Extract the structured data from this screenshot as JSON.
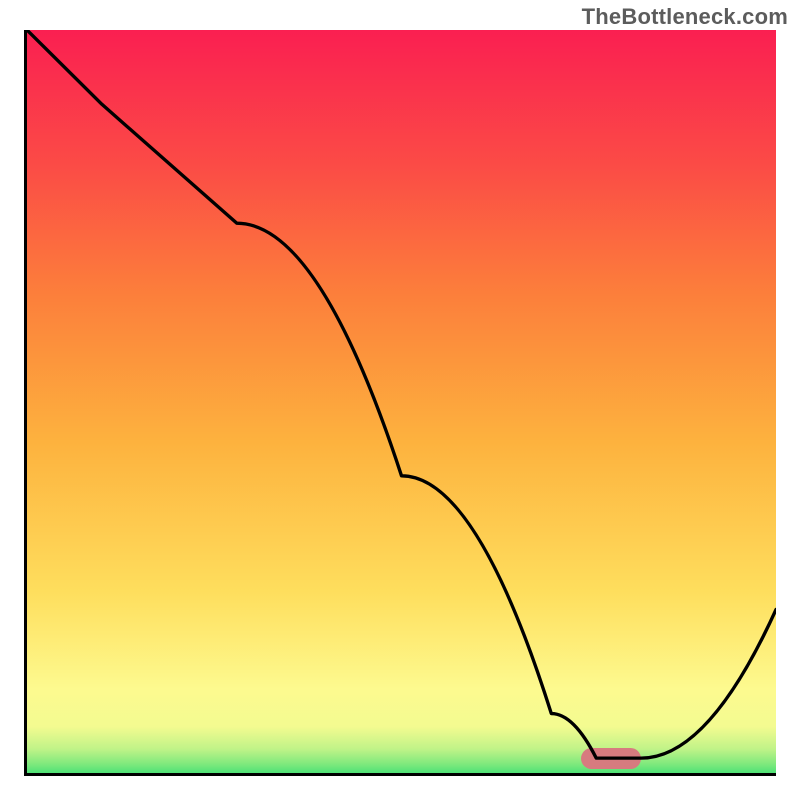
{
  "watermark": "TheBottleneck.com",
  "chart_data": {
    "type": "line",
    "title": "",
    "xlabel": "",
    "ylabel": "",
    "xlim": [
      0,
      100
    ],
    "ylim": [
      0,
      100
    ],
    "grid": false,
    "legend": false,
    "series": [
      {
        "name": "bottleneck-curve",
        "x": [
          0,
          10,
          28,
          50,
          70,
          76,
          82,
          100
        ],
        "y": [
          100,
          90,
          74,
          40,
          8,
          2,
          2,
          22
        ]
      }
    ],
    "annotations": [
      {
        "name": "optimal-zone",
        "shape": "pill",
        "x_center": 78,
        "y_center": 2,
        "width": 8,
        "height": 2,
        "color": "#d77b7f"
      }
    ],
    "gradient_stops": [
      {
        "offset": 0.0,
        "color": "#2fdd72"
      },
      {
        "offset": 0.02,
        "color": "#7fe97d"
      },
      {
        "offset": 0.04,
        "color": "#c0f388"
      },
      {
        "offset": 0.07,
        "color": "#f3fb90"
      },
      {
        "offset": 0.12,
        "color": "#fdfa8f"
      },
      {
        "offset": 0.25,
        "color": "#fede5d"
      },
      {
        "offset": 0.45,
        "color": "#fdb23e"
      },
      {
        "offset": 0.65,
        "color": "#fc7e3b"
      },
      {
        "offset": 0.82,
        "color": "#fb4b46"
      },
      {
        "offset": 1.0,
        "color": "#fa1f51"
      }
    ]
  }
}
